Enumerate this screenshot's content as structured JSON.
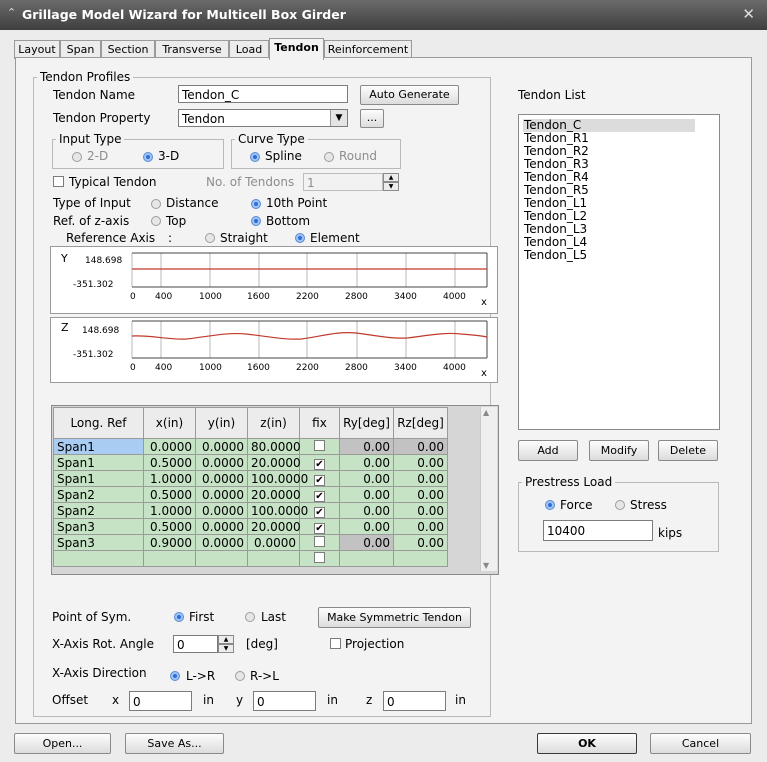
{
  "window": {
    "title": "Grillage Model Wizard for Multicell Box Girder"
  },
  "tabs": [
    "Layout",
    "Span",
    "Section",
    "Transverse",
    "Load",
    "Tendon",
    "Reinforcement"
  ],
  "profiles": {
    "group_title": "Tendon Profiles",
    "tendon_name_label": "Tendon Name",
    "tendon_name_value": "Tendon_C",
    "auto_generate": "Auto Generate",
    "tendon_property_label": "Tendon Property",
    "tendon_property_value": "Tendon",
    "more_button": "...",
    "input_type": {
      "title": "Input Type",
      "opt1": "2-D",
      "opt2": "3-D"
    },
    "curve_type": {
      "title": "Curve Type",
      "opt1": "Spline",
      "opt2": "Round"
    },
    "typical_tendon": "Typical Tendon",
    "no_of_tendons_label": "No. of Tendons",
    "no_of_tendons_value": "1",
    "type_of_input_label": "Type of Input",
    "type_of_input_opt1": "Distance",
    "type_of_input_opt2": "10th Point",
    "ref_z_label": "Ref. of z-axis",
    "ref_z_opt1": "Top",
    "ref_z_opt2": "Bottom",
    "ref_axis_label": "Reference Axis",
    "ref_axis_colon": ":",
    "ref_axis_opt1": "Straight",
    "ref_axis_opt2": "Element"
  },
  "graph_y": {
    "axis": "Y",
    "ymax": "148.698",
    "ymin": "-351.302",
    "xlabel": "x",
    "ticks": [
      "0",
      "400",
      "1000",
      "1600",
      "2200",
      "2800",
      "3400",
      "4000"
    ]
  },
  "graph_z": {
    "axis": "Z",
    "ymax": "148.698",
    "ymin": "-351.302",
    "xlabel": "x",
    "ticks": [
      "0",
      "400",
      "1000",
      "1600",
      "2200",
      "2800",
      "3400",
      "4000"
    ]
  },
  "table": {
    "headers": [
      "Long. Ref",
      "x(in)",
      "y(in)",
      "z(in)",
      "fix",
      "Ry[deg]",
      "Rz[deg]"
    ],
    "rows": [
      [
        "Span1",
        "0.0000",
        "0.0000",
        "80.0000",
        "",
        "0.00",
        "0.00"
      ],
      [
        "Span1",
        "0.5000",
        "0.0000",
        "20.0000",
        "✔",
        "0.00",
        "0.00"
      ],
      [
        "Span1",
        "1.0000",
        "0.0000",
        "100.0000",
        "✔",
        "0.00",
        "0.00"
      ],
      [
        "Span2",
        "0.5000",
        "0.0000",
        "20.0000",
        "✔",
        "0.00",
        "0.00"
      ],
      [
        "Span2",
        "1.0000",
        "0.0000",
        "100.0000",
        "✔",
        "0.00",
        "0.00"
      ],
      [
        "Span3",
        "0.5000",
        "0.0000",
        "20.0000",
        "✔",
        "0.00",
        "0.00"
      ],
      [
        "Span3",
        "0.9000",
        "0.0000",
        "0.0000",
        "",
        "0.00",
        "0.00"
      ]
    ]
  },
  "sym": {
    "point_label": "Point of Sym.",
    "opt1": "First",
    "opt2": "Last",
    "make_button": "Make Symmetric Tendon",
    "rot_label": "X-Axis Rot. Angle",
    "rot_value": "0",
    "rot_unit": "[deg]",
    "projection": "Projection",
    "dir_label": "X-Axis Direction",
    "dir_opt1": "L->R",
    "dir_opt2": "R->L",
    "offset_label": "Offset",
    "x_label": "x",
    "x_value": "0",
    "x_unit": "in",
    "y_label": "y",
    "y_value": "0",
    "y_unit": "in",
    "z_label": "z",
    "z_value": "0",
    "z_unit": "in"
  },
  "tendon_list": {
    "title": "Tendon List",
    "items": [
      "Tendon_C",
      "Tendon_R1",
      "Tendon_R2",
      "Tendon_R3",
      "Tendon_R4",
      "Tendon_R5",
      "Tendon_L1",
      "Tendon_L2",
      "Tendon_L3",
      "Tendon_L4",
      "Tendon_L5"
    ],
    "add": "Add",
    "modify": "Modify",
    "delete": "Delete"
  },
  "prestress": {
    "title": "Prestress Load",
    "opt1": "Force",
    "opt2": "Stress",
    "value": "10400",
    "unit": "kips"
  },
  "footer": {
    "open": "Open...",
    "save_as": "Save As...",
    "ok": "OK",
    "cancel": "Cancel"
  },
  "colors": {
    "accent_radio": "#2d6fd4",
    "grid_green": "#c6e3c6",
    "graph_line": "#c0392b"
  }
}
